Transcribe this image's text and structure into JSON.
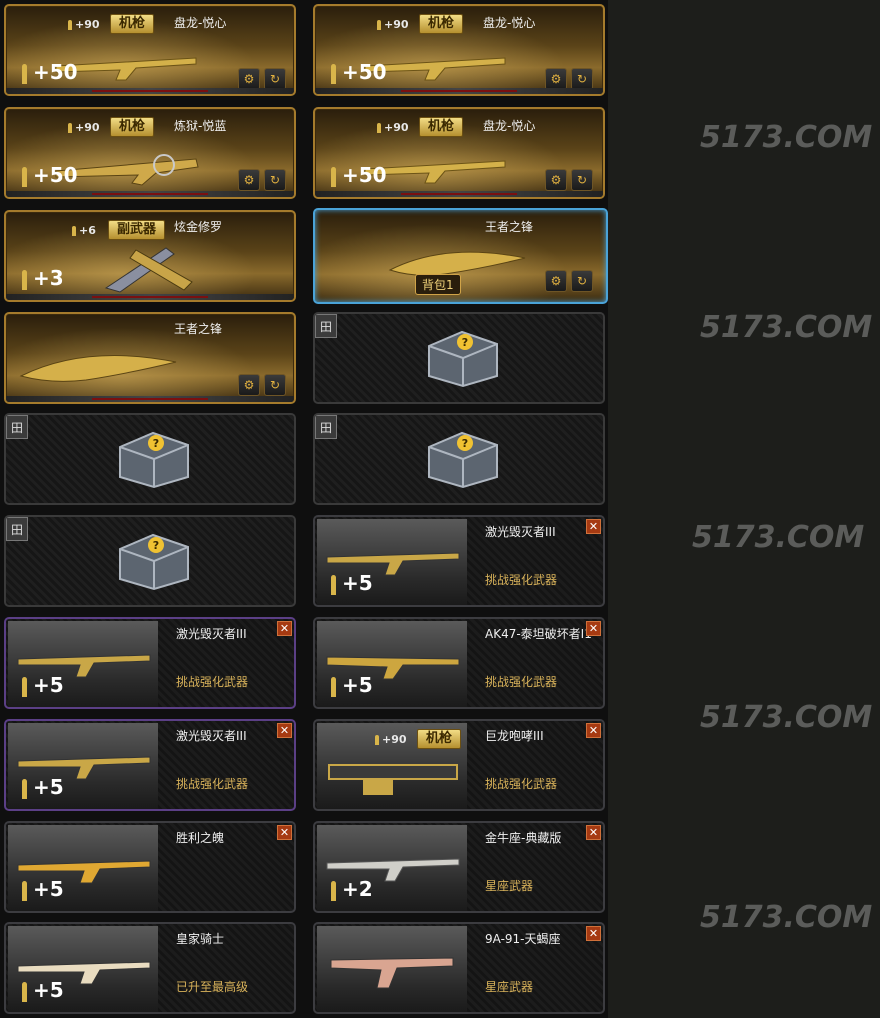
{
  "cards": [
    {
      "name": "盘龙-悦心",
      "ammo": "+90",
      "type": "机枪",
      "big": "+50"
    },
    {
      "name": "盘龙-悦心",
      "ammo": "+90",
      "type": "机枪",
      "big": "+50"
    },
    {
      "name": "炼狱-悦蓝",
      "ammo": "+90",
      "type": "机枪",
      "big": "+50"
    },
    {
      "name": "盘龙-悦心",
      "ammo": "+90",
      "type": "机枪",
      "big": "+50"
    },
    {
      "name": "炫金修罗",
      "ammo": "+6",
      "type": "副武器",
      "big": "+3"
    },
    {
      "name": "王者之锋",
      "pack": "背包1"
    },
    {
      "name": "王者之锋"
    },
    {
      "name": "激光毁灭者III",
      "big": "+5",
      "sub": "挑战强化武器"
    },
    {
      "name": "激光毁灭者III",
      "big": "+5",
      "sub": "挑战强化武器"
    },
    {
      "name": "AK47-泰坦破坏者I1",
      "big": "+5",
      "sub": "挑战强化武器"
    },
    {
      "name": "激光毁灭者III",
      "big": "+5",
      "sub": "挑战强化武器"
    },
    {
      "name": "巨龙咆哮III",
      "ammo": "+90",
      "type": "机枪",
      "sub": "挑战强化武器"
    },
    {
      "name": "胜利之魄",
      "big": "+5"
    },
    {
      "name": "金牛座-典藏版",
      "big": "+2",
      "sub": "星座武器"
    },
    {
      "name": "皇家骑士",
      "big": "+5",
      "sub": "已升至最高级"
    },
    {
      "name": "9A-91-天蝎座",
      "sub": "星座武器"
    }
  ],
  "watermark": {
    "logo": "5173.COM"
  },
  "icons": {
    "upgrade": "wrench-icon",
    "refresh": "refresh-icon",
    "close": "close-icon",
    "slot": "slot-icon",
    "mystery": "mystery-box-icon"
  }
}
